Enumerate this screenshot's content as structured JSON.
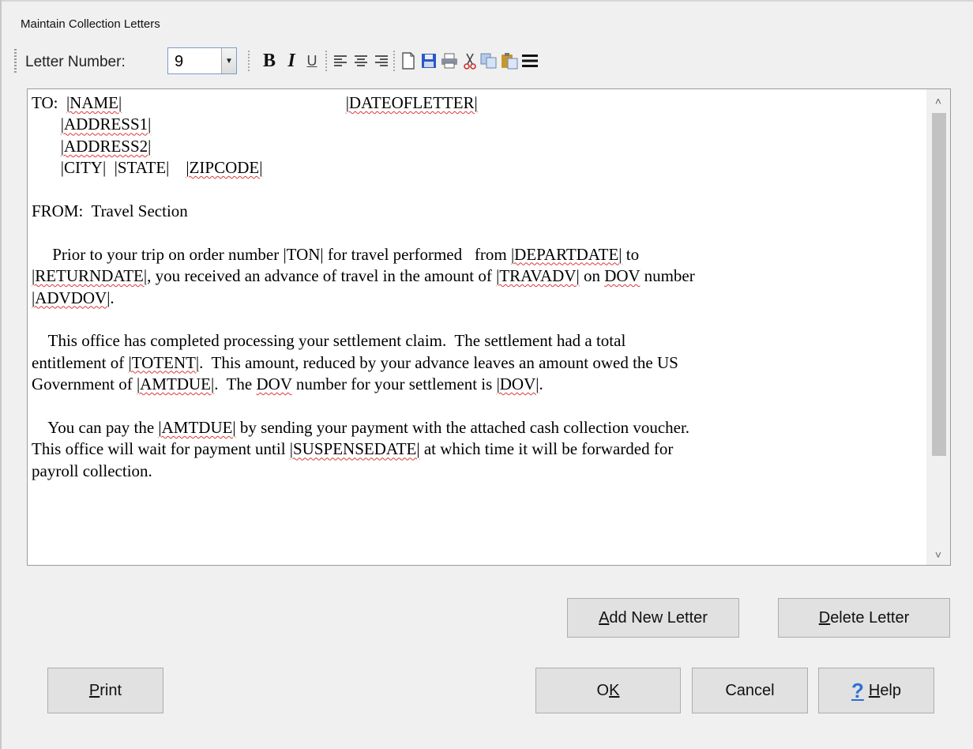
{
  "window": {
    "title": "Maintain Collection Letters"
  },
  "toolbar": {
    "letter_number_label": "Letter Number:",
    "letter_number_value": "9",
    "icons": [
      "bold-icon",
      "italic-icon",
      "underline-icon",
      "align-left-icon",
      "align-center-icon",
      "align-right-icon",
      "new-document-icon",
      "save-icon",
      "print-icon",
      "cut-icon",
      "copy-icon",
      "paste-icon",
      "menu-icon"
    ]
  },
  "letter": {
    "lines": [
      {
        "parts": [
          {
            "t": "TO:  "
          },
          {
            "t": "|NAME|",
            "sq": true
          },
          {
            "t": "                                                      "
          },
          {
            "t": "|DATEOFLETTER|",
            "sq": true
          }
        ]
      },
      {
        "parts": [
          {
            "t": "       "
          },
          {
            "t": "|ADDRESS1|",
            "sq": true
          }
        ]
      },
      {
        "parts": [
          {
            "t": "       "
          },
          {
            "t": "|ADDRESS2|",
            "sq": true
          }
        ]
      },
      {
        "parts": [
          {
            "t": "       |CITY|  |STATE|    "
          },
          {
            "t": "|ZIPCODE|",
            "sq": true
          }
        ]
      },
      {
        "blank": true
      },
      {
        "parts": [
          {
            "t": "FROM:  Travel Section"
          }
        ]
      },
      {
        "blank": true
      },
      {
        "parts": [
          {
            "t": "     Prior to your trip on order number |TON| for travel performed   from "
          },
          {
            "t": "|DEPARTDATE|",
            "sq": true
          },
          {
            "t": " to"
          }
        ]
      },
      {
        "parts": [
          {
            "t": "|RETURNDATE|",
            "sq": true
          },
          {
            "t": ", you received an advance of travel in the amount of "
          },
          {
            "t": "|TRAVADV|",
            "sq": true
          },
          {
            "t": " on "
          },
          {
            "t": "DOV",
            "sq": true
          },
          {
            "t": " number"
          }
        ]
      },
      {
        "parts": [
          {
            "t": "|ADVDOV|",
            "sq": true
          },
          {
            "t": "."
          }
        ]
      },
      {
        "blank": true
      },
      {
        "parts": [
          {
            "t": "    This office has completed processing your settlement claim.  The settlement had a total"
          }
        ]
      },
      {
        "parts": [
          {
            "t": "entitlement of "
          },
          {
            "t": "|TOTENT|",
            "sq": true
          },
          {
            "t": ".  This amount, reduced by your advance leaves an amount owed the US"
          }
        ]
      },
      {
        "parts": [
          {
            "t": "Government of "
          },
          {
            "t": "|AMTDUE|",
            "sq": true
          },
          {
            "t": ".  The "
          },
          {
            "t": "DOV",
            "sq": true
          },
          {
            "t": " number for your settlement is "
          },
          {
            "t": "|DOV|",
            "sq": true
          },
          {
            "t": "."
          }
        ]
      },
      {
        "blank": true
      },
      {
        "parts": [
          {
            "t": "    You can pay the "
          },
          {
            "t": "|AMTDUE|",
            "sq": true
          },
          {
            "t": " by sending your payment with the attached cash collection voucher."
          }
        ]
      },
      {
        "parts": [
          {
            "t": "This office will wait for payment until "
          },
          {
            "t": "|SUSPENSEDATE|",
            "sq": true
          },
          {
            "t": " at which time it will be forwarded for"
          }
        ]
      },
      {
        "parts": [
          {
            "t": "payroll collection."
          }
        ]
      }
    ]
  },
  "buttons": {
    "add_new_letter": {
      "mnemonic": "A",
      "rest": "dd New Letter"
    },
    "delete_letter": {
      "mnemonic": "D",
      "rest": "elete Letter"
    },
    "print": {
      "mnemonic": "P",
      "rest": "rint"
    },
    "ok": {
      "pre": "O",
      "mnemonic": "K",
      "rest": ""
    },
    "cancel": "Cancel",
    "help": {
      "mnemonic": "H",
      "rest": "elp"
    }
  },
  "colors": {
    "accent": "#2d6fd6",
    "spell_squiggle": "#d93a3a",
    "dialog_bg": "#f0f0f0"
  }
}
